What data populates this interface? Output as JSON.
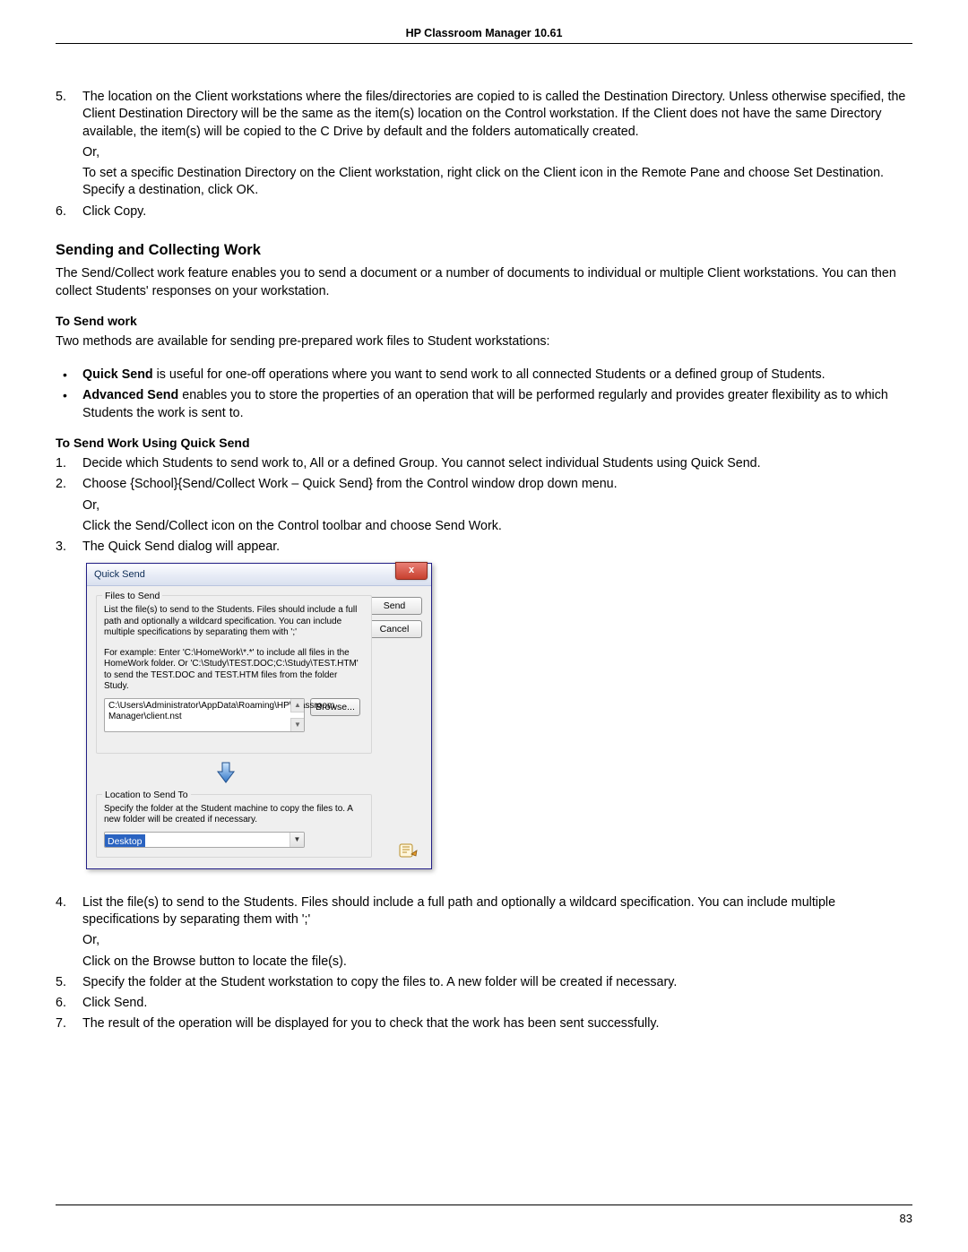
{
  "header": {
    "title": "HP Classroom Manager 10.61"
  },
  "page_number": "83",
  "step5_p1": "The location on the Client workstations where the files/directories are copied to is called the Destination Directory. Unless otherwise specified, the Client Destination Directory will be the same as the item(s) location on the Control workstation. If the Client does not have the same Directory available, the item(s) will be copied to the C Drive by default and the folders automatically created.",
  "or_label": "Or,",
  "step5_p2": "To set a specific Destination Directory on the Client workstation, right click on the Client icon in the Remote Pane and choose Set Destination. Specify a destination, click OK.",
  "step6": "Click Copy.",
  "section_title": "Sending and Collecting Work",
  "section_intro": "The Send/Collect work feature enables you to send a document or a number of documents to individual or multiple Client workstations. You can then collect Students' responses on your workstation.",
  "to_send_work_heading": "To Send work",
  "to_send_intro": "Two methods are available for sending pre-prepared work files to Student workstations:",
  "bullets": {
    "quick_label": "Quick Send",
    "quick_text": " is useful for one-off operations where you want to send work to all  connected Students or a defined group of Students.",
    "adv_label": "Advanced Send",
    "adv_text": " enables you to store the properties of an operation that will be performed regularly and provides greater flexibility as to which Students the work is sent to."
  },
  "quick_send_heading": "To Send Work Using Quick Send",
  "qs_steps": {
    "s1": "Decide which Students to send work to, All or a defined Group. You cannot select individual Students using Quick Send.",
    "s2a": "Choose {School}{Send/Collect Work – Quick Send} from the Control window drop down menu.",
    "s2b": "Click the Send/Collect icon on the Control toolbar and choose Send Work.",
    "s3": "The Quick Send dialog will appear."
  },
  "dialog": {
    "title": "Quick Send",
    "close": "x",
    "send_btn": "Send",
    "cancel_btn": "Cancel",
    "browse_btn": "Browse...",
    "files_legend": "Files to Send",
    "files_help1": "List the file(s) to send to the Students. Files should include a full path and optionally a wildcard specification. You can include multiple specifications by separating them with ';'",
    "files_help2": "For example: Enter 'C:\\HomeWork\\*.*' to include all files in the HomeWork folder. Or 'C:\\Study\\TEST.DOC;C:\\Study\\TEST.HTM' to send the TEST.DOC and TEST.HTM files from the folder Study.",
    "path_value": "C:\\Users\\Administrator\\AppData\\Roaming\\HP\\Classroom Manager\\client.nst",
    "loc_legend": "Location to Send To",
    "loc_help": "Specify the folder at the Student machine to copy the files to. A new folder will be created if necessary.",
    "loc_value": "Desktop"
  },
  "post_steps": {
    "s4a": "List the file(s) to send to the Students. Files should include a full path and optionally a wildcard specification. You can include multiple specifications by separating them with ';'",
    "s4b": "Click on the Browse button to locate the file(s).",
    "s5": "Specify the folder at the Student workstation to copy the files to. A new folder will be created if necessary.",
    "s6": "Click Send.",
    "s7": "The result of the operation will be displayed for you to check that the work has been sent successfully."
  }
}
